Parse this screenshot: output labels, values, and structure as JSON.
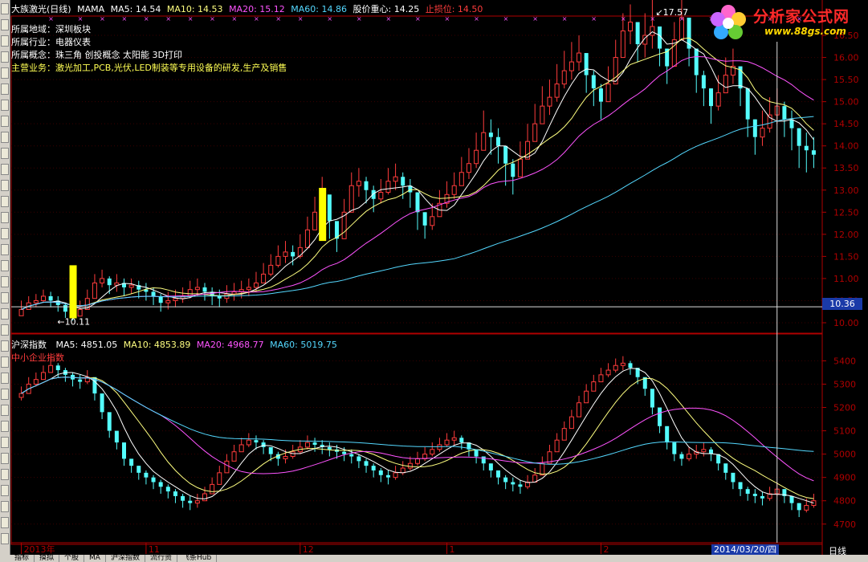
{
  "header": {
    "title": "大族激光(日线)",
    "indicator": "MAMA",
    "ma5": "MA5: 14.54",
    "ma10": "MA10: 14.53",
    "ma20": "MA20: 15.12",
    "ma60": "MA60: 14.86",
    "center": "股价重心: 14.25",
    "stoploss": "止损位: 14.50"
  },
  "info": {
    "region": "所属地域：深圳板块",
    "industry": "所属行业：电器仪表",
    "concept": "所属概念：珠三角 创投概念 太阳能 3D打印",
    "business": "主营业务：激光加工,PCB,光伏,LED制装等专用设备的研发,生产及销售"
  },
  "logo": {
    "brand": "分析家公式网",
    "url": "www.88gs.com"
  },
  "lower_header": {
    "title": "沪深指数",
    "ma5": "MA5: 4851.05",
    "ma10": "MA10: 4853.89",
    "ma20": "MA20: 4968.77",
    "ma60": "MA60: 5019.75",
    "sub": "中小企业指数"
  },
  "crosshair": {
    "price": "10.36",
    "date": "2014/03/20/四"
  },
  "period_label": "日线",
  "bottom_tabs": [
    "指标",
    "摸拟",
    "个股",
    "MA",
    "沪深指数",
    "流行资",
    "飞条Hub"
  ],
  "colors": {
    "up": "#ff3c3c",
    "down": "#54fcfc",
    "ma5": "#ffffff",
    "ma10": "#ffff80",
    "ma20": "#ff54ff",
    "ma60": "#54d8ff",
    "axis": "#b00000",
    "highlight": "#ffff00"
  },
  "chart_data": [
    {
      "type": "candlestick",
      "title": "大族激光(日线)",
      "ylim": [
        9.8,
        16.9
      ],
      "yticks": [
        10.0,
        10.5,
        11.0,
        11.5,
        12.0,
        12.5,
        13.0,
        13.5,
        14.0,
        14.5,
        15.0,
        15.5,
        16.0,
        16.5
      ],
      "annotations": [
        {
          "text": "17.57",
          "value": 17.57
        },
        {
          "text": "10.11",
          "value": 10.11
        }
      ],
      "close": [
        10.3,
        10.45,
        10.5,
        10.6,
        10.5,
        10.4,
        10.25,
        10.15,
        10.3,
        10.55,
        10.9,
        11.0,
        10.85,
        10.9,
        10.8,
        10.85,
        10.75,
        10.7,
        10.6,
        10.45,
        10.5,
        10.55,
        10.6,
        10.75,
        10.8,
        10.7,
        10.6,
        10.55,
        10.65,
        10.7,
        10.75,
        10.8,
        10.9,
        11.1,
        11.3,
        11.5,
        11.6,
        11.5,
        11.7,
        12.1,
        12.5,
        12.9,
        12.3,
        11.9,
        12.5,
        13.1,
        13.2,
        13.0,
        12.8,
        12.95,
        13.2,
        13.3,
        13.1,
        12.95,
        12.5,
        12.2,
        12.4,
        12.7,
        12.9,
        13.1,
        13.4,
        13.6,
        13.9,
        14.3,
        14.2,
        14.0,
        13.6,
        13.3,
        13.7,
        14.1,
        14.5,
        14.9,
        15.1,
        15.4,
        15.7,
        15.9,
        16.1,
        15.6,
        15.3,
        15.0,
        15.4,
        16.0,
        16.6,
        16.8,
        16.3,
        16.5,
        16.7,
        16.2,
        15.8,
        16.4,
        16.9,
        16.2,
        15.6,
        15.3,
        14.9,
        15.2,
        15.6,
        15.8,
        15.3,
        14.6,
        14.2,
        14.4,
        14.7,
        14.9,
        14.6,
        14.4,
        14.0,
        13.9,
        13.8
      ],
      "high": [
        10.5,
        10.6,
        10.65,
        10.75,
        10.7,
        10.6,
        10.45,
        10.4,
        10.5,
        10.75,
        11.1,
        11.2,
        11.05,
        11.1,
        11.0,
        11.0,
        10.95,
        10.9,
        10.8,
        10.65,
        10.7,
        10.75,
        10.8,
        10.95,
        11.0,
        10.9,
        10.8,
        10.75,
        10.85,
        10.9,
        10.95,
        11.0,
        11.15,
        11.35,
        11.55,
        11.75,
        11.85,
        11.75,
        12.0,
        12.4,
        12.85,
        13.3,
        12.6,
        12.2,
        12.8,
        13.4,
        13.5,
        13.3,
        13.1,
        13.25,
        13.5,
        13.6,
        13.4,
        13.25,
        12.85,
        12.5,
        12.7,
        13.0,
        13.2,
        13.4,
        13.75,
        13.95,
        14.3,
        14.8,
        14.6,
        14.4,
        14.0,
        13.7,
        14.1,
        14.5,
        14.95,
        15.35,
        15.5,
        15.85,
        16.15,
        16.35,
        16.5,
        16.0,
        15.7,
        15.4,
        15.8,
        16.4,
        17.0,
        17.2,
        16.7,
        17.0,
        17.57,
        16.6,
        16.2,
        16.8,
        17.3,
        16.6,
        16.0,
        15.7,
        15.3,
        15.6,
        16.0,
        16.2,
        15.7,
        15.0,
        14.6,
        14.8,
        15.1,
        15.3,
        15.0,
        14.8,
        14.4,
        14.3,
        14.2
      ],
      "low": [
        10.2,
        10.3,
        10.35,
        10.45,
        10.35,
        10.25,
        10.11,
        10.05,
        10.15,
        10.4,
        10.7,
        10.8,
        10.65,
        10.7,
        10.6,
        10.65,
        10.55,
        10.5,
        10.4,
        10.25,
        10.3,
        10.35,
        10.45,
        10.55,
        10.6,
        10.5,
        10.4,
        10.35,
        10.45,
        10.5,
        10.55,
        10.6,
        10.7,
        10.9,
        11.05,
        11.25,
        11.35,
        11.3,
        11.45,
        11.8,
        12.2,
        12.5,
        11.9,
        11.6,
        12.2,
        12.7,
        12.85,
        12.7,
        12.5,
        12.7,
        12.9,
        13.0,
        12.8,
        12.6,
        12.1,
        11.9,
        12.1,
        12.4,
        12.6,
        12.8,
        13.1,
        13.25,
        13.5,
        13.9,
        13.8,
        13.6,
        13.1,
        12.9,
        13.3,
        13.7,
        14.1,
        14.5,
        14.7,
        15.0,
        15.3,
        15.5,
        15.7,
        15.2,
        14.9,
        14.6,
        15.0,
        15.6,
        16.1,
        16.3,
        15.9,
        16.0,
        16.2,
        15.8,
        15.4,
        15.9,
        16.4,
        15.8,
        15.2,
        14.9,
        14.5,
        14.8,
        15.2,
        15.4,
        14.9,
        14.2,
        13.8,
        14.0,
        14.3,
        14.5,
        14.2,
        13.9,
        13.5,
        13.4,
        13.5
      ]
    },
    {
      "type": "candlestick",
      "title": "沪深指数",
      "ylim": [
        4620,
        5460
      ],
      "yticks": [
        4700,
        4800,
        4900,
        5000,
        5100,
        5200,
        5300,
        5400
      ],
      "xticks": [
        {
          "label": "2013年",
          "index": 0
        },
        {
          "label": "11",
          "index": 17
        },
        {
          "label": "12",
          "index": 38
        },
        {
          "label": "1",
          "index": 58
        },
        {
          "label": "2",
          "index": 79
        },
        {
          "label": "3",
          "index": 95
        }
      ],
      "close": [
        5260,
        5300,
        5320,
        5350,
        5380,
        5360,
        5340,
        5320,
        5310,
        5330,
        5260,
        5180,
        5100,
        5050,
        4980,
        4950,
        4920,
        4900,
        4880,
        4860,
        4840,
        4820,
        4800,
        4790,
        4800,
        4830,
        4870,
        4920,
        4970,
        5010,
        5040,
        5060,
        5050,
        5030,
        5000,
        4980,
        4990,
        5010,
        5030,
        5050,
        5040,
        5030,
        5020,
        5010,
        5000,
        4990,
        4970,
        4950,
        4930,
        4910,
        4900,
        4920,
        4940,
        4960,
        4980,
        5000,
        5020,
        5040,
        5060,
        5070,
        5050,
        5020,
        4990,
        4960,
        4930,
        4900,
        4880,
        4870,
        4860,
        4880,
        4910,
        4960,
        5010,
        5060,
        5110,
        5160,
        5220,
        5270,
        5310,
        5340,
        5360,
        5380,
        5390,
        5370,
        5330,
        5280,
        5200,
        5120,
        5050,
        5000,
        4980,
        5000,
        5010,
        5020,
        5000,
        4960,
        4920,
        4880,
        4850,
        4830,
        4820,
        4810,
        4830,
        4850,
        4820,
        4790,
        4760,
        4780,
        4800
      ],
      "high": [
        5290,
        5330,
        5350,
        5380,
        5420,
        5390,
        5370,
        5350,
        5340,
        5360,
        5290,
        5210,
        5130,
        5080,
        5010,
        4980,
        4950,
        4930,
        4910,
        4890,
        4870,
        4850,
        4830,
        4820,
        4830,
        4860,
        4900,
        4950,
        5000,
        5040,
        5070,
        5090,
        5080,
        5060,
        5030,
        5010,
        5020,
        5040,
        5060,
        5080,
        5070,
        5060,
        5050,
        5040,
        5030,
        5020,
        5000,
        4980,
        4960,
        4940,
        4930,
        4950,
        4970,
        4990,
        5010,
        5030,
        5050,
        5070,
        5090,
        5100,
        5080,
        5050,
        5020,
        4990,
        4960,
        4930,
        4910,
        4900,
        4890,
        4910,
        4940,
        4990,
        5040,
        5090,
        5140,
        5190,
        5250,
        5300,
        5340,
        5370,
        5390,
        5410,
        5420,
        5400,
        5360,
        5310,
        5230,
        5150,
        5080,
        5030,
        5010,
        5030,
        5040,
        5050,
        5030,
        4990,
        4950,
        4910,
        4880,
        4860,
        4850,
        4840,
        4860,
        4880,
        4850,
        4820,
        4790,
        4810,
        4830
      ],
      "low": [
        5230,
        5270,
        5290,
        5320,
        5350,
        5330,
        5310,
        5290,
        5280,
        5300,
        5230,
        5150,
        5070,
        5020,
        4950,
        4920,
        4890,
        4870,
        4850,
        4830,
        4810,
        4790,
        4770,
        4760,
        4770,
        4800,
        4840,
        4890,
        4940,
        4980,
        5010,
        5030,
        5020,
        5000,
        4970,
        4950,
        4960,
        4980,
        5000,
        5020,
        5010,
        5000,
        4990,
        4980,
        4970,
        4960,
        4940,
        4920,
        4900,
        4880,
        4870,
        4890,
        4910,
        4930,
        4950,
        4970,
        4990,
        5010,
        5030,
        5040,
        5020,
        4990,
        4960,
        4930,
        4900,
        4870,
        4850,
        4840,
        4830,
        4850,
        4880,
        4930,
        4980,
        5030,
        5080,
        5130,
        5190,
        5240,
        5280,
        5310,
        5330,
        5350,
        5360,
        5340,
        5300,
        5250,
        5170,
        5090,
        5020,
        4970,
        4950,
        4970,
        4980,
        4990,
        4970,
        4930,
        4890,
        4850,
        4820,
        4800,
        4790,
        4780,
        4800,
        4820,
        4790,
        4760,
        4730,
        4750,
        4770
      ]
    }
  ]
}
